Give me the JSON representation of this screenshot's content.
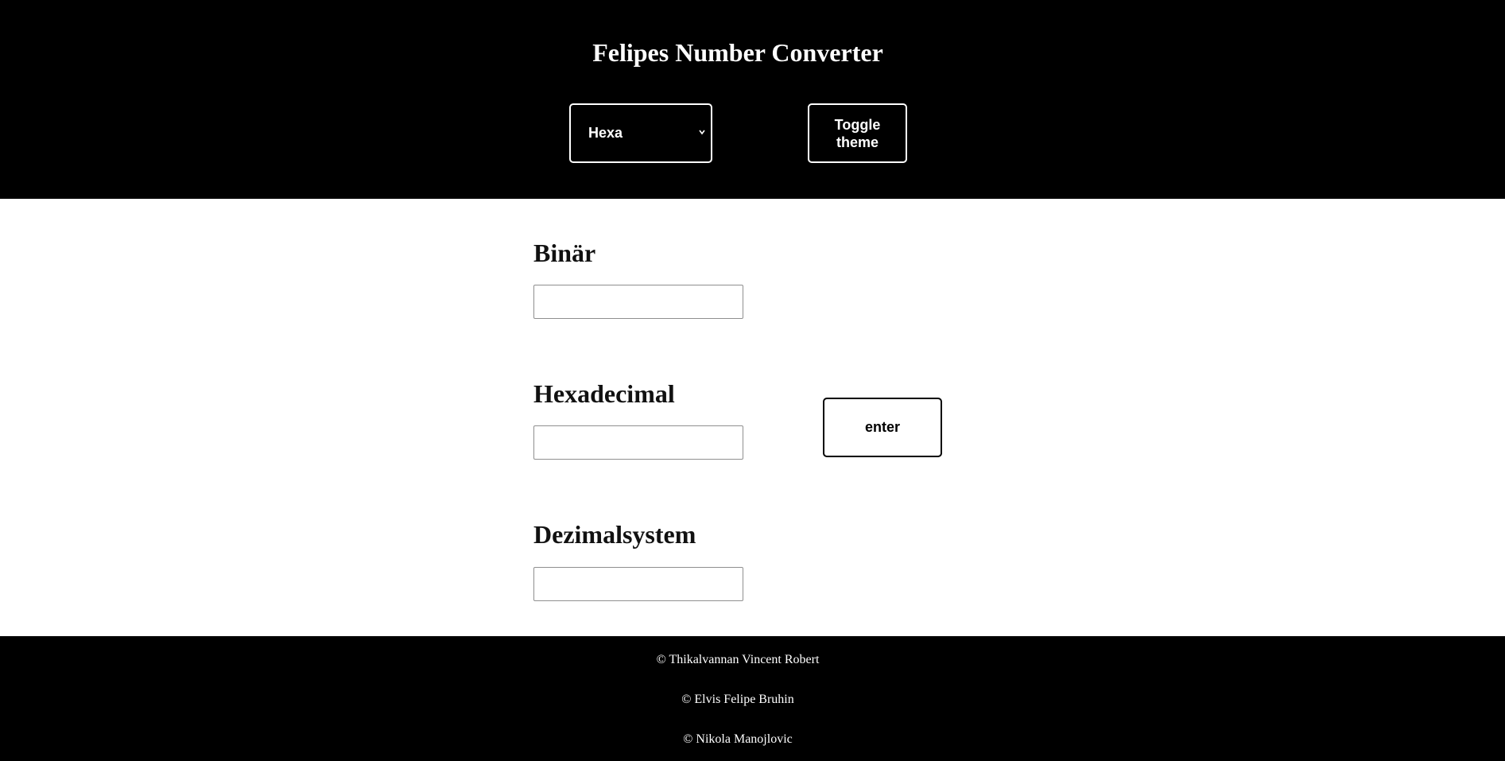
{
  "header": {
    "title": "Felipes Number Converter",
    "mode_select": {
      "selected": "Hexa",
      "chevron_icon": "chevron-down-icon"
    },
    "toggle_theme_label": "Toggle theme"
  },
  "main": {
    "fields": [
      {
        "label": "Binär",
        "value": "",
        "placeholder": ""
      },
      {
        "label": "Hexadecimal",
        "value": "",
        "placeholder": ""
      },
      {
        "label": "Dezimalsystem",
        "value": "",
        "placeholder": ""
      }
    ],
    "enter_label": "enter"
  },
  "footer": {
    "credits": [
      "© Thikalvannan Vincent Robert",
      "© Elvis Felipe Bruhin",
      "© Nikola Manojlovic"
    ]
  },
  "colors": {
    "header_bg": "#000000",
    "footer_bg": "#000000",
    "main_bg": "#ffffff",
    "accent_text": "#ffffff"
  }
}
